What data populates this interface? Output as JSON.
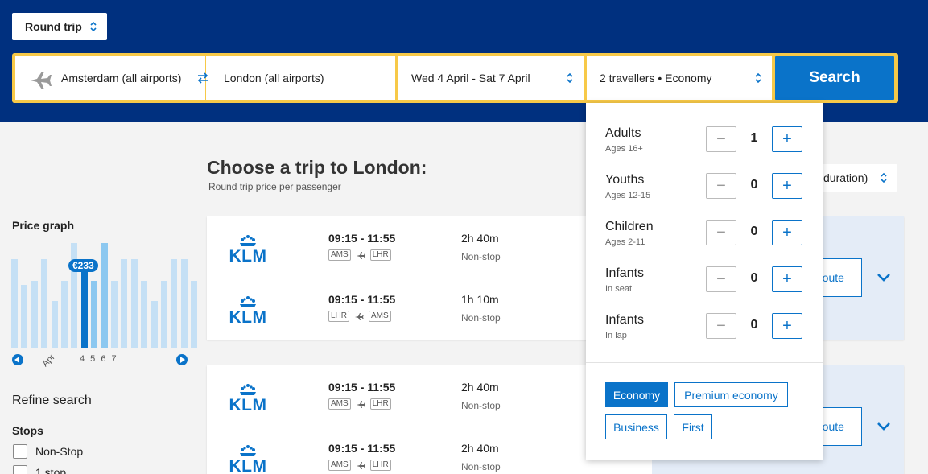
{
  "header": {
    "trip_type": "Round trip",
    "from": "Amsterdam (all airports)",
    "to": "London (all airports)",
    "dates": "Wed 4 April - Sat 7 April",
    "travellers": "2 travellers • Economy",
    "search_label": "Search",
    "colors": {
      "background": "#00307f",
      "accent": "#f7c948",
      "button": "#0a73c9"
    }
  },
  "sidebar": {
    "price_graph_title": "Price graph",
    "price_tag": "€233",
    "axis_month": "Apr",
    "axis_days": "4 5 6 7",
    "bar_heights": [
      0.82,
      0.58,
      0.62,
      0.82,
      0.43,
      0.62,
      0.97,
      0.82,
      0.62,
      0.97,
      0.62,
      0.82,
      0.82,
      0.62,
      0.43,
      0.62,
      0.82,
      0.82,
      0.62
    ],
    "selected_index": 7,
    "refine_title": "Refine search",
    "stops_title": "Stops",
    "stops": [
      "Non-Stop",
      "1 stop"
    ]
  },
  "main": {
    "title": "Choose a trip to London:",
    "subtitle": "Round trip price per passenger",
    "sort_label": "duration)",
    "route_label": "route",
    "cards": [
      {
        "legs": [
          {
            "airline": "KLM",
            "times": "09:15 - 11:55",
            "from": "AMS",
            "to": "LHR",
            "duration": "2h 40m",
            "stops": "Non-stop"
          },
          {
            "airline": "KLM",
            "times": "09:15 - 11:55",
            "from": "LHR",
            "to": "AMS",
            "duration": "1h 10m",
            "stops": "Non-stop"
          }
        ]
      },
      {
        "legs": [
          {
            "airline": "KLM",
            "times": "09:15 - 11:55",
            "from": "AMS",
            "to": "LHR",
            "duration": "2h 40m",
            "stops": "Non-stop"
          },
          {
            "airline": "KLM",
            "times": "09:15 - 11:55",
            "from": "AMS",
            "to": "LHR",
            "duration": "2h 40m",
            "stops": "Non-stop"
          }
        ]
      }
    ]
  },
  "travellers_dropdown": {
    "rows": [
      {
        "label": "Adults",
        "sub": "Ages 16+",
        "count": "1"
      },
      {
        "label": "Youths",
        "sub": "Ages 12-15",
        "count": "0"
      },
      {
        "label": "Children",
        "sub": "Ages 2-11",
        "count": "0"
      },
      {
        "label": "Infants",
        "sub": "In seat",
        "count": "0"
      },
      {
        "label": "Infants",
        "sub": "In lap",
        "count": "0"
      }
    ],
    "cabins": [
      "Economy",
      "Premium economy",
      "Business",
      "First"
    ],
    "selected_cabin": "Economy",
    "minus_symbol": "−",
    "plus_symbol": "+"
  }
}
